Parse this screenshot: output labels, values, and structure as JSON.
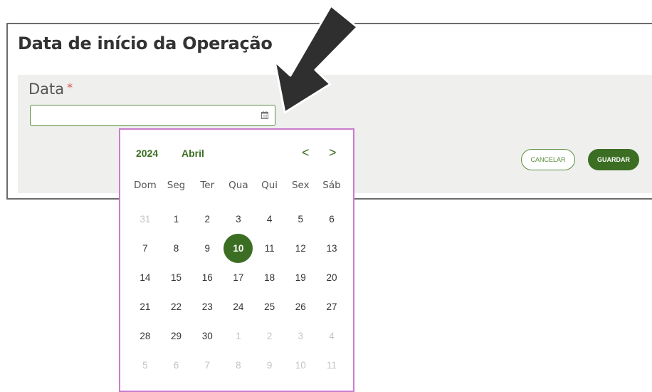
{
  "dialog": {
    "title": "Data de início da Operação",
    "field_label": "Data",
    "required_mark": "*",
    "date_value": "",
    "cancel_label": "CANCELAR",
    "save_label": "GUARDAR"
  },
  "calendar": {
    "year": "2024",
    "month": "Abril",
    "prev_label": "<",
    "next_label": ">",
    "weekdays": [
      "Dom",
      "Seg",
      "Ter",
      "Qua",
      "Qui",
      "Sex",
      "Sáb"
    ],
    "selected_day": "10",
    "days": [
      {
        "label": "31",
        "muted": true
      },
      {
        "label": "1",
        "muted": false
      },
      {
        "label": "2",
        "muted": false
      },
      {
        "label": "3",
        "muted": false
      },
      {
        "label": "4",
        "muted": false
      },
      {
        "label": "5",
        "muted": false
      },
      {
        "label": "6",
        "muted": false
      },
      {
        "label": "7",
        "muted": false
      },
      {
        "label": "8",
        "muted": false
      },
      {
        "label": "9",
        "muted": false
      },
      {
        "label": "10",
        "muted": false
      },
      {
        "label": "11",
        "muted": false
      },
      {
        "label": "12",
        "muted": false
      },
      {
        "label": "13",
        "muted": false
      },
      {
        "label": "14",
        "muted": false
      },
      {
        "label": "15",
        "muted": false
      },
      {
        "label": "16",
        "muted": false
      },
      {
        "label": "17",
        "muted": false
      },
      {
        "label": "18",
        "muted": false
      },
      {
        "label": "19",
        "muted": false
      },
      {
        "label": "20",
        "muted": false
      },
      {
        "label": "21",
        "muted": false
      },
      {
        "label": "22",
        "muted": false
      },
      {
        "label": "23",
        "muted": false
      },
      {
        "label": "24",
        "muted": false
      },
      {
        "label": "25",
        "muted": false
      },
      {
        "label": "26",
        "muted": false
      },
      {
        "label": "27",
        "muted": false
      },
      {
        "label": "28",
        "muted": false
      },
      {
        "label": "29",
        "muted": false
      },
      {
        "label": "30",
        "muted": false
      },
      {
        "label": "1",
        "muted": true
      },
      {
        "label": "2",
        "muted": true
      },
      {
        "label": "3",
        "muted": true
      },
      {
        "label": "4",
        "muted": true
      },
      {
        "label": "5",
        "muted": true
      },
      {
        "label": "6",
        "muted": true
      },
      {
        "label": "7",
        "muted": true
      },
      {
        "label": "8",
        "muted": true
      },
      {
        "label": "9",
        "muted": true
      },
      {
        "label": "10",
        "muted": true
      },
      {
        "label": "11",
        "muted": true
      }
    ]
  },
  "colors": {
    "accent": "#3b6e22",
    "popup_border": "#c97ccf",
    "arrow": "#2f2f2f"
  },
  "icons": {
    "field_icon": "calendar-icon",
    "annotation": "pointer-arrow-icon"
  }
}
